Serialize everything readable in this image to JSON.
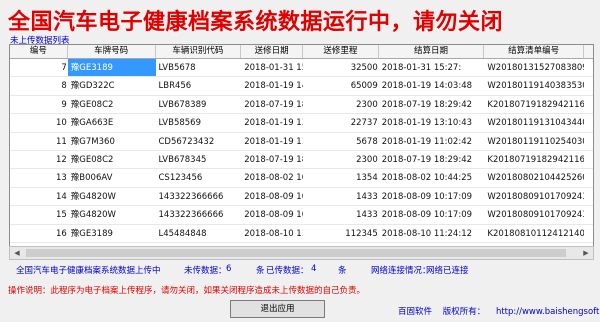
{
  "app": {
    "title": "全国汽车电子健康档案系统数据运行中，请勿关闭"
  },
  "table": {
    "group_label": "未上传数据列表",
    "columns": [
      "编号",
      "车牌号码",
      "车辆识别代码",
      "送修日期",
      "送修里程",
      "结算日期",
      "结算清单编号"
    ],
    "rows": [
      [
        "7",
        "豫GE3189",
        "LVB5678",
        "2018-01-31 15:27:",
        "32500",
        "2018-01-31 15:27:",
        "W20180131527083809",
        "",
        ""
      ],
      [
        "8",
        "豫GD322C",
        "LBR456",
        "2018-01-19 14:03:",
        "65009",
        "2018-01-19 14:03:48",
        "W20180119140383530",
        "",
        ""
      ],
      [
        "9",
        "豫GE08C2",
        "LVB678389",
        "2018-07-19 18:29:",
        "2300",
        "2018-07-19 18:29:42",
        "K20180719182942116",
        "",
        ""
      ],
      [
        "10",
        "豫GA663E",
        "LVB58569",
        "2018-01-19 13:10:",
        "22737",
        "2018-01-19 13:10:43",
        "W20180119131043440",
        "",
        ""
      ],
      [
        "11",
        "豫G7M360",
        "CD56723432",
        "2018-01-19 11:02:",
        "5678",
        "2018-01-19 11:02:42",
        "W20180119110254030",
        "",
        ""
      ],
      [
        "12",
        "豫GE08C2",
        "LVB678345",
        "2018-07-19 18:29:",
        "2300",
        "2018-07-19 18:29:42",
        "K20180719182942116",
        "",
        ""
      ],
      [
        "13",
        "豫B006AV",
        "CS123456",
        "2018-08-02 10:44:",
        "1354",
        "2018-08-02 10:44:25",
        "W20180802104425260",
        "",
        ""
      ],
      [
        "14",
        "豫G4820W",
        "143322366666",
        "2018-08-09 10:17:",
        "1433",
        "2018-08-09 10:17:09",
        "W20180809101709243",
        "",
        ""
      ],
      [
        "15",
        "豫G4820W",
        "143322366666",
        "2018-08-09 10:17:",
        "1433",
        "2018-08-09 10:17:09",
        "W20180809101709243",
        "",
        ""
      ],
      [
        "16",
        "豫GE3189",
        "L45484848",
        "2018-08-10 11:24:",
        "112345",
        "2018-08-10 11:24:12",
        "K20180810112412140",
        "",
        ""
      ]
    ],
    "selected_cell_text": "豫GE3189"
  },
  "status": {
    "service_label": "全国汽车电子健康档案系统数据上传中",
    "not_uploaded_label": "未传数据：",
    "not_uploaded_count": "6",
    "unit1": "条",
    "uploaded_label": "已传数据：",
    "uploaded_count": "4",
    "unit2": "条",
    "network_label": "网络连接情况：",
    "network_value": "网络已连接"
  },
  "hint": "操作说明：此程序为电子档案上传程序，请勿关闭，如果关闭程序造成未上传数据的自己负责。",
  "buttons": {
    "exit": "退出应用"
  },
  "copyright": {
    "company": "百固软件",
    "rights": "版权所有：",
    "url": "http://www.baishengsoft.com"
  }
}
